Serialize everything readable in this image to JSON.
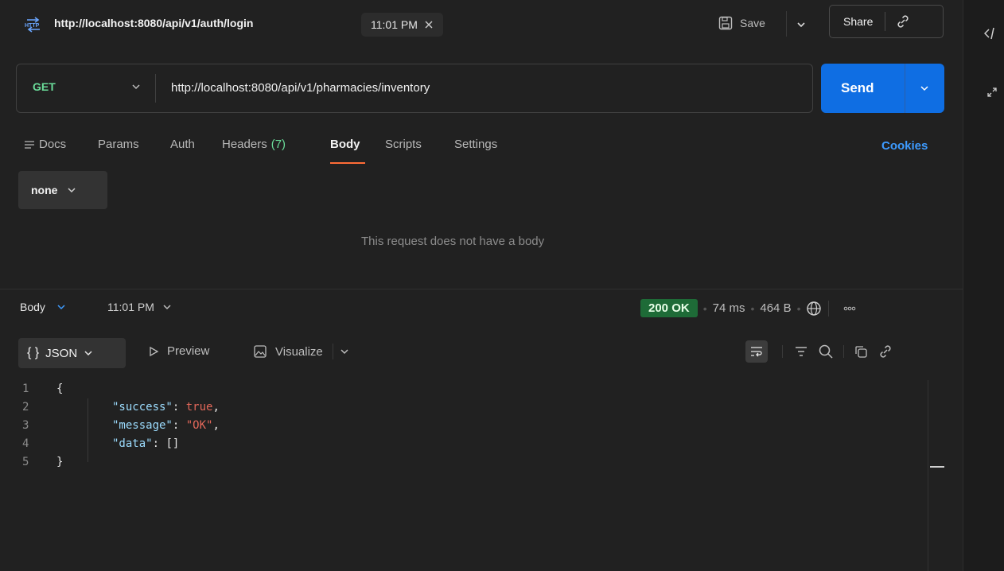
{
  "tab": {
    "title": "http://localhost:8080/api/v1/auth/login",
    "time": "11:01 PM",
    "save_label": "Save",
    "share_label": "Share"
  },
  "request": {
    "method": "GET",
    "url": "http://localhost:8080/api/v1/pharmacies/inventory",
    "send_label": "Send"
  },
  "request_tabs": {
    "docs": "Docs",
    "params": "Params",
    "auth": "Auth",
    "headers": "Headers",
    "headers_count": "(7)",
    "body": "Body",
    "scripts": "Scripts",
    "settings": "Settings",
    "cookies": "Cookies"
  },
  "body": {
    "type": "none",
    "empty_message": "This request does not have a body"
  },
  "response": {
    "section": "Body",
    "time": "11:01 PM",
    "status": "200 OK",
    "duration": "74 ms",
    "size": "464 B",
    "format": "JSON",
    "preview": "Preview",
    "visualize": "Visualize"
  },
  "code": {
    "line_numbers": [
      "1",
      "2",
      "3",
      "4",
      "5"
    ],
    "open_brace": "{",
    "close_brace": "}",
    "k1": "\"success\"",
    "v1": "true",
    "k2": "\"message\"",
    "v2": "\"OK\"",
    "k3": "\"data\"",
    "v3": "[]"
  },
  "colors": {
    "accent": "#ff6c37",
    "send": "#0f6ee3",
    "status_ok": "#1e6b37",
    "method": "#6bdd9a",
    "link": "#3d9bff"
  },
  "icons": {
    "http": "http-icon",
    "close": "close-icon",
    "save": "save-icon",
    "chevron": "chevron-down-icon",
    "link": "link-icon",
    "code": "code-icon",
    "docs": "docs-icon",
    "globe": "globe-icon",
    "more": "more-icon",
    "wrap": "wrap-icon",
    "filter": "filter-icon",
    "search": "search-icon",
    "copy": "copy-icon"
  }
}
